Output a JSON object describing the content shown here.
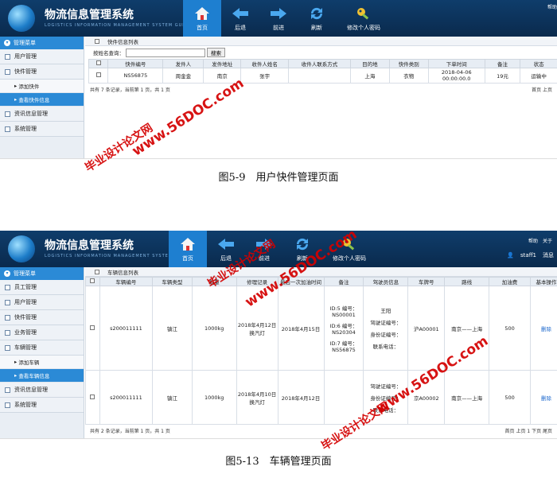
{
  "app": {
    "title": "物流信息管理系统",
    "subtitle": "LOGISTICS INFORMATION MANAGEMENT SYSTEM GUI",
    "nav": [
      {
        "label": "首页",
        "icon": "home-icon"
      },
      {
        "label": "后退",
        "icon": "arrow-left-icon"
      },
      {
        "label": "前进",
        "icon": "arrow-right-icon"
      },
      {
        "label": "刷新",
        "icon": "refresh-icon"
      },
      {
        "label": "修改个人密码",
        "icon": "key-icon"
      }
    ],
    "help": "帮助",
    "about": "关于",
    "user": "staff1",
    "messages": "消息",
    "accent": "#2b8ad6",
    "topbar_color": "#0f3d6b"
  },
  "shot1": {
    "sidebar": {
      "header": "管理菜单",
      "items": [
        "用户管理",
        "快件管理"
      ],
      "subitems": [
        "添加快件",
        "查看快件信息"
      ],
      "items_after": [
        "资讯信息管理",
        "系统管理"
      ]
    },
    "panel_title": "快件信息列表",
    "search_label": "按姓名查询：",
    "search_button": "搜索",
    "columns": [
      "快件编号",
      "发件人",
      "发件地址",
      "收件人姓名",
      "收件人联系方式",
      "目的地",
      "快件类别",
      "下单时间",
      "备注",
      "状态"
    ],
    "rows": [
      [
        "NS56875",
        "周金金",
        "南京",
        "张宇",
        "",
        "上海",
        "衣物",
        "2018-04-06 00:00:00.0",
        "19元",
        "运输中"
      ]
    ],
    "pager_left": "共有 7 条记录，当前第 1 页，共 1 页",
    "pager_right": "首页 上页"
  },
  "caption1": "图5-9　用户快件管理页面",
  "shot2": {
    "sidebar": {
      "header": "管理菜单",
      "items": [
        "员工管理",
        "用户管理",
        "快件管理",
        "业务管理",
        "车辆管理"
      ],
      "subitems": [
        "添加车辆",
        "查看车辆信息"
      ],
      "items_after": [
        "资讯信息管理",
        "系统管理"
      ]
    },
    "panel_title": "车辆信息列表",
    "columns": [
      "车辆编号",
      "车辆类型",
      "载重",
      "修理记录",
      "最后一次加油时间",
      "备注",
      "驾驶员信息",
      "车牌号",
      "路线",
      "加油费",
      "基本操作"
    ],
    "rows": [
      {
        "id": "s200011111",
        "type": "镇江",
        "load": "1000kg",
        "repair": "2018年4月12日 换汽灯",
        "refuel": "2018年4月15日",
        "notes": [
          "ID:5 编号：NS00001",
          "ID:6 编号：NS20304",
          "ID:7 编号：NS56875"
        ],
        "driver": [
          "王阳",
          "驾驶证编号：",
          "身份证编号：",
          "联系电话："
        ],
        "plate": "沪A00001",
        "route": "南京——上海",
        "fee": "500",
        "ops": "删除"
      },
      {
        "id": "s200011111",
        "type": "镇江",
        "load": "1000kg",
        "repair": "2018年4月10日 换汽灯",
        "refuel": "2018年4月12日",
        "notes": [],
        "driver": [
          "驾驶证编号：",
          "身份证编号：",
          "联系电话："
        ],
        "plate": "京A00002",
        "route": "南京——上海",
        "fee": "500",
        "ops": "删除"
      }
    ],
    "pager_left": "共有 2 条记录，当前第 1 页，共 1 页",
    "pager_right": "首页 上页 1 下页 尾页"
  },
  "caption2": "图5-13　车辆管理页面",
  "watermarks": {
    "site": "www.56DOC.com",
    "cn": "毕业设计论文网",
    "color": "#d40000"
  }
}
